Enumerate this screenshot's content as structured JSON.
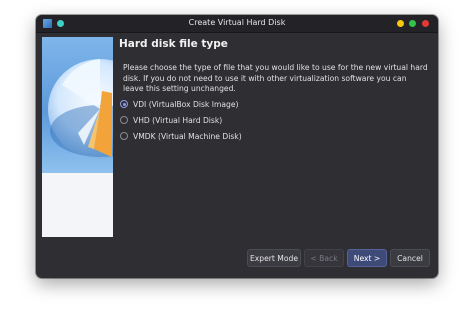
{
  "window": {
    "title": "Create Virtual Hard Disk"
  },
  "page": {
    "heading": "Hard disk file type",
    "description": "Please choose the type of file that you would like to use for the new virtual hard disk. If you do not need to use it with other virtualization software you can leave this setting unchanged."
  },
  "options": [
    {
      "label": "VDI (VirtualBox Disk Image)",
      "selected": true
    },
    {
      "label": "VHD (Virtual Hard Disk)",
      "selected": false
    },
    {
      "label": "VMDK (Virtual Machine Disk)",
      "selected": false
    }
  ],
  "buttons": {
    "expert": "Expert Mode",
    "back": "< Back",
    "next": "Next >",
    "cancel": "Cancel"
  },
  "colors": {
    "window_bg": "#2e2e33",
    "accent": "#8f9be8",
    "minimize": "#f6c90e",
    "maximize": "#36c24a",
    "close": "#e53935"
  }
}
